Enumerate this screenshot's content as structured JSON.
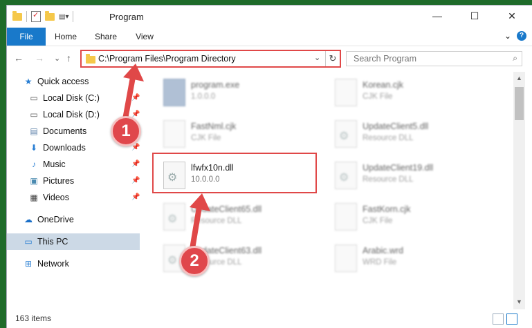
{
  "window": {
    "title": "Program",
    "controls": {
      "minimize": "—",
      "maximize": "☐",
      "close": "✕"
    }
  },
  "ribbon": {
    "tabs": [
      "File",
      "Home",
      "Share",
      "View"
    ],
    "expand_glyph": "⌄",
    "help_glyph": "?"
  },
  "address": {
    "path": "C:\\Program Files\\Program Directory",
    "dropdown_glyph": "⌄",
    "refresh_glyph": "↻",
    "search_placeholder": "Search Program",
    "search_glyph": "⌕"
  },
  "nav": {
    "back": "←",
    "forward": "→",
    "recent": "⌄",
    "up": "↑",
    "items": [
      {
        "label": "Quick access",
        "icon": "star-icon",
        "glyph": "★",
        "pinned": false
      },
      {
        "label": "Local Disk (C:)",
        "icon": "drive-icon",
        "glyph": "▭",
        "pinned": true
      },
      {
        "label": "Local Disk (D:)",
        "icon": "drive-icon",
        "glyph": "▭",
        "pinned": true
      },
      {
        "label": "Documents",
        "icon": "document-icon",
        "glyph": "▤",
        "pinned": true
      },
      {
        "label": "Downloads",
        "icon": "download-icon",
        "glyph": "⬇",
        "pinned": true
      },
      {
        "label": "Music",
        "icon": "music-icon",
        "glyph": "♪",
        "pinned": true
      },
      {
        "label": "Pictures",
        "icon": "pictures-icon",
        "glyph": "▣",
        "pinned": true
      },
      {
        "label": "Videos",
        "icon": "video-icon",
        "glyph": "▦",
        "pinned": true
      },
      {
        "label": "OneDrive",
        "icon": "cloud-icon",
        "glyph": "☁",
        "pinned": false
      },
      {
        "label": "This PC",
        "icon": "computer-icon",
        "glyph": "▭",
        "pinned": false
      },
      {
        "label": "Network",
        "icon": "network-icon",
        "glyph": "⊞",
        "pinned": false
      }
    ],
    "pin_glyph": "📌"
  },
  "files": [
    {
      "name": "program.exe",
      "sub": "1.0.0.0",
      "type": "exe"
    },
    {
      "name": "Korean.cjk",
      "sub": "CJK File",
      "type": "file"
    },
    {
      "name": "FastNml.cjk",
      "sub": "CJK File",
      "type": "file"
    },
    {
      "name": "UpdateClient5.dll",
      "sub": "Resource DLL",
      "type": "dll"
    },
    {
      "name": "lfwfx10n.dll",
      "sub": "10.0.0.0",
      "type": "dll"
    },
    {
      "name": "UpdateClient19.dll",
      "sub": "Resource DLL",
      "type": "dll"
    },
    {
      "name": "UpdateClient65.dll",
      "sub": "Resource DLL",
      "type": "dll"
    },
    {
      "name": "FastKorn.cjk",
      "sub": "CJK File",
      "type": "file"
    },
    {
      "name": "UpdateClient63.dll",
      "sub": "Resource DLL",
      "type": "dll"
    },
    {
      "name": "Arabic.wrd",
      "sub": "WRD File",
      "type": "file"
    }
  ],
  "status": {
    "count": "163 items"
  },
  "callouts": [
    "1",
    "2"
  ],
  "colors": {
    "accent": "#1979ca",
    "highlight": "#e04848",
    "selected": "#ccd9e6"
  }
}
